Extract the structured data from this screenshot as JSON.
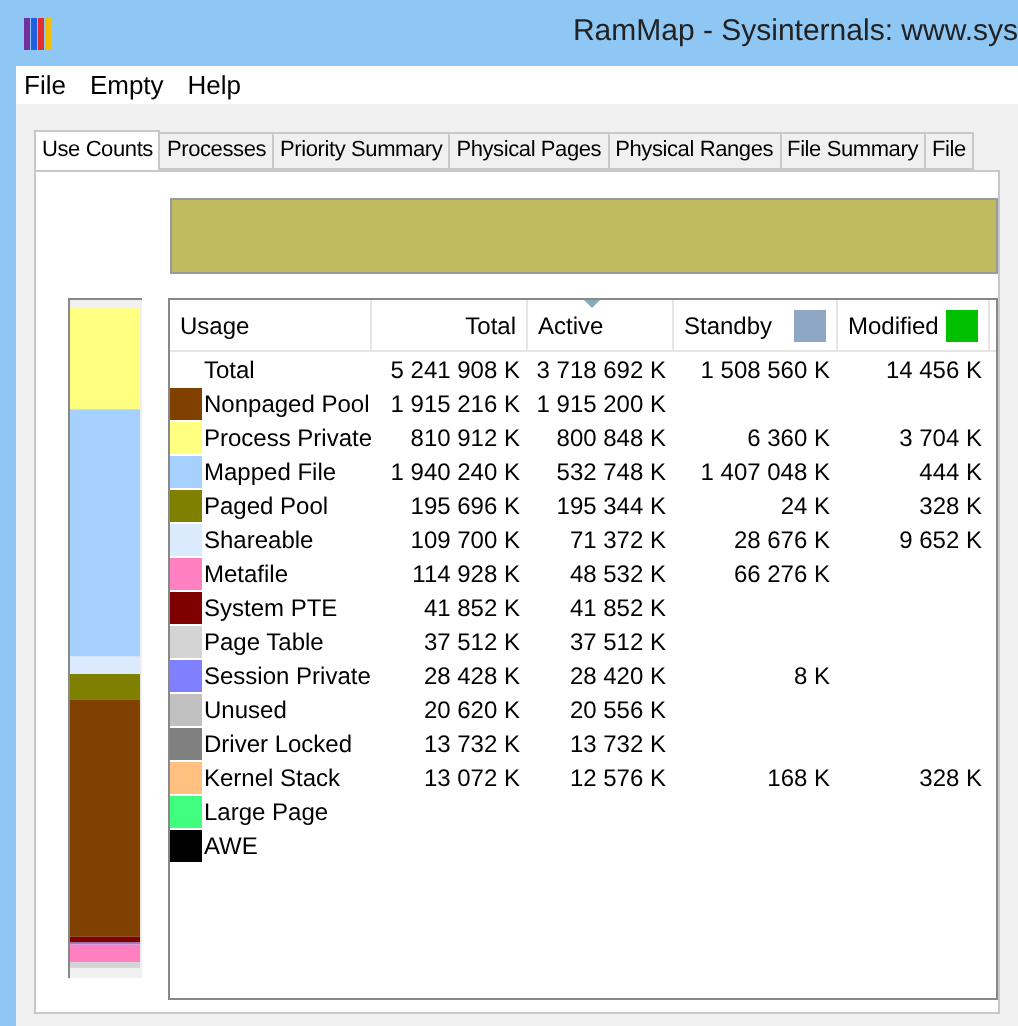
{
  "window": {
    "title": "RamMap - Sysinternals: www.sys"
  },
  "menu": [
    "File",
    "Empty",
    "Help"
  ],
  "tabs": [
    {
      "label": "Use Counts",
      "selected": true
    },
    {
      "label": "Processes",
      "selected": false
    },
    {
      "label": "Priority Summary",
      "selected": false
    },
    {
      "label": "Physical Pages",
      "selected": false
    },
    {
      "label": "Physical Ranges",
      "selected": false
    },
    {
      "label": "File Summary",
      "selected": false
    },
    {
      "label": "File",
      "selected": false
    }
  ],
  "table": {
    "columns": [
      {
        "label": "Usage"
      },
      {
        "label": "Total"
      },
      {
        "label": "Active",
        "sorted": true
      },
      {
        "label": "Standby",
        "color": "#8ea7c4"
      },
      {
        "label": "Modified",
        "color": "#00c000"
      }
    ],
    "rows": [
      {
        "usage": "Total",
        "total": "5 241 908 K",
        "active": "3 718 692 K",
        "standby": "1 508 560 K",
        "modified": "14 456 K"
      },
      {
        "usage": "Nonpaged Pool",
        "color": "#804000",
        "total": "1 915 216 K",
        "active": "1 915 200 K"
      },
      {
        "usage": "Process Private",
        "color": "#ffff80",
        "total": "810 912 K",
        "active": "800 848 K",
        "standby": "6 360 K",
        "modified": "3 704 K"
      },
      {
        "usage": "Mapped File",
        "color": "#a6d0ff",
        "total": "1 940 240 K",
        "active": "532 748 K",
        "standby": "1 407 048 K",
        "modified": "444 K"
      },
      {
        "usage": "Paged Pool",
        "color": "#808000",
        "total": "195 696 K",
        "active": "195 344 K",
        "standby": "24 K",
        "modified": "328 K"
      },
      {
        "usage": "Shareable",
        "color": "#dbeafc",
        "total": "109 700 K",
        "active": "71 372 K",
        "standby": "28 676 K",
        "modified": "9 652 K"
      },
      {
        "usage": "Metafile",
        "color": "#ff80c0",
        "total": "114 928 K",
        "active": "48 532 K",
        "standby": "66 276 K"
      },
      {
        "usage": "System PTE",
        "color": "#800000",
        "total": "41 852 K",
        "active": "41 852 K"
      },
      {
        "usage": "Page Table",
        "color": "#d4d4d4",
        "total": "37 512 K",
        "active": "37 512 K"
      },
      {
        "usage": "Session Private",
        "color": "#8080ff",
        "total": "28 428 K",
        "active": "28 420 K",
        "standby": "8 K"
      },
      {
        "usage": "Unused",
        "color": "#c0c0c0",
        "total": "20 620 K",
        "active": "20 556 K"
      },
      {
        "usage": "Driver Locked",
        "color": "#808080",
        "total": "13 732 K",
        "active": "13 732 K"
      },
      {
        "usage": "Kernel Stack",
        "color": "#ffc080",
        "total": "13 072 K",
        "active": "12 576 K",
        "standby": "168 K",
        "modified": "328 K"
      },
      {
        "usage": "Large Page",
        "color": "#40ff80"
      },
      {
        "usage": "AWE",
        "color": "#000000"
      }
    ]
  }
}
